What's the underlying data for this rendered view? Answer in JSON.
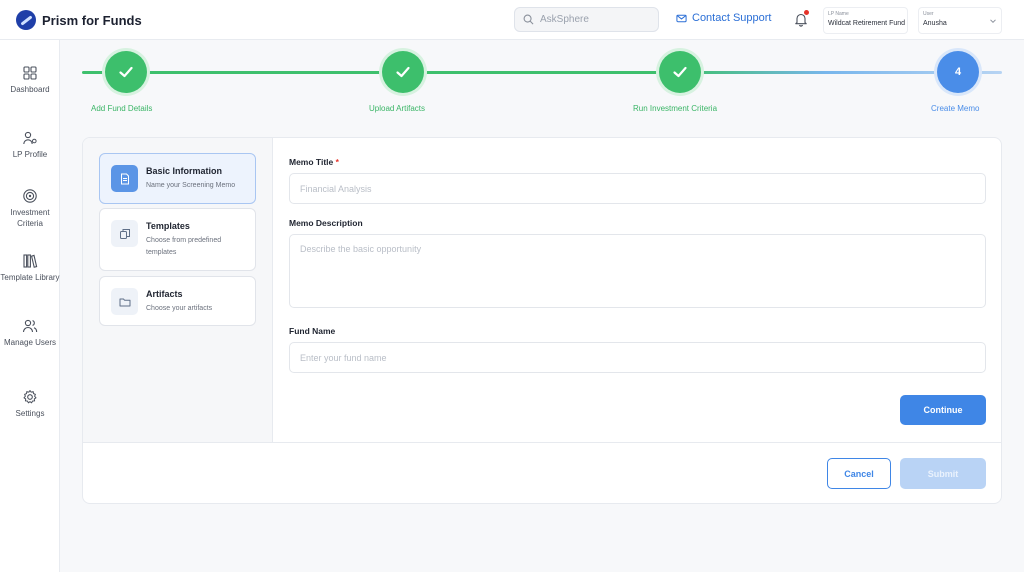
{
  "app": {
    "title": "Prism for Funds"
  },
  "header": {
    "search_placeholder": "AskSphere",
    "contact_label": "Contact Support",
    "lp": {
      "label": "LP Name",
      "value": "Wildcat Retirement Fund"
    },
    "user": {
      "label": "User",
      "value": "Anusha"
    }
  },
  "sidebar": {
    "items": [
      {
        "label": "Dashboard"
      },
      {
        "label": "LP Profile"
      },
      {
        "label": "Investment Criteria"
      },
      {
        "label": "Template Library"
      },
      {
        "label": "Manage Users"
      },
      {
        "label": "Settings"
      }
    ]
  },
  "stepper": {
    "steps": [
      {
        "label": "Add Fund Details",
        "status": "complete"
      },
      {
        "label": "Upload Artifacts",
        "status": "complete"
      },
      {
        "label": "Run Investment Criteria",
        "status": "complete"
      },
      {
        "label": "Create Memo",
        "number": "4",
        "status": "active"
      }
    ]
  },
  "sections": [
    {
      "title": "Basic Information",
      "subtitle": "Name your Screening Memo",
      "icon": "document-icon",
      "active": true
    },
    {
      "title": "Templates",
      "subtitle": "Choose from predefined templates",
      "icon": "copy-icon",
      "active": false
    },
    {
      "title": "Artifacts",
      "subtitle": "Choose your artifacts",
      "icon": "folder-icon",
      "active": false
    }
  ],
  "form": {
    "memo_title": {
      "label": "Memo Title",
      "required_mark": "*",
      "placeholder": "Financial Analysis"
    },
    "memo_description": {
      "label": "Memo Description",
      "placeholder": "Describe the basic opportunity"
    },
    "fund_name": {
      "label": "Fund Name",
      "placeholder": "Enter your fund name"
    },
    "continue_label": "Continue"
  },
  "actions": {
    "cancel_label": "Cancel",
    "submit_label": "Submit"
  },
  "colors": {
    "primary": "#3f86e6",
    "success": "#3dbf6c",
    "required": "#e5332a"
  }
}
